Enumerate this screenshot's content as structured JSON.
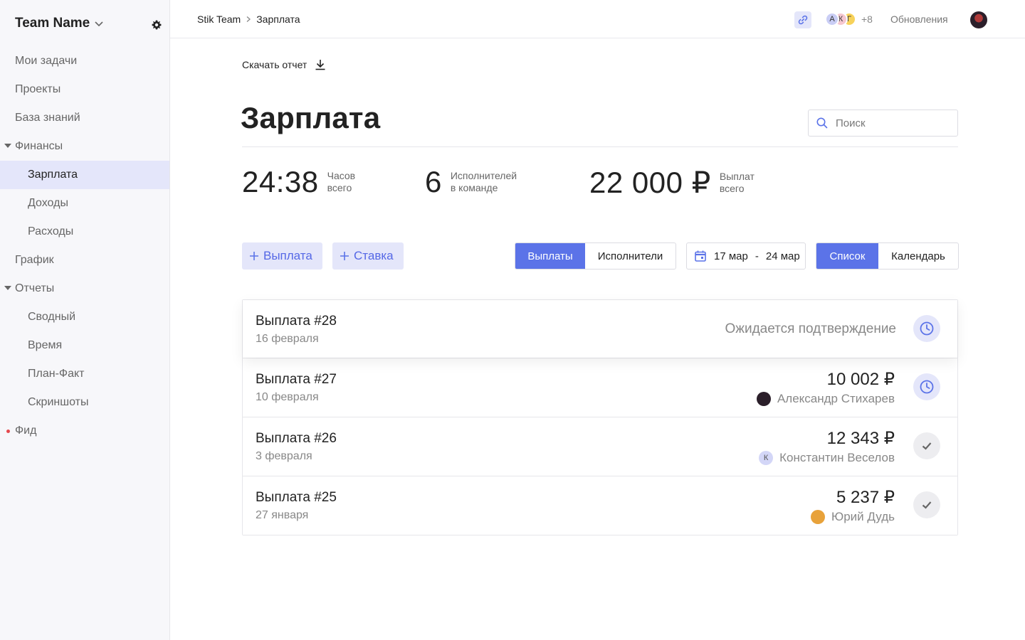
{
  "sidebar": {
    "team_name": "Team Name",
    "items": [
      {
        "label": "Мои задачи",
        "level": 0
      },
      {
        "label": "Проекты",
        "level": 0
      },
      {
        "label": "База знаний",
        "level": 0
      },
      {
        "label": "Финансы",
        "level": 0,
        "expanded": true
      },
      {
        "label": "Зарплата",
        "level": 1,
        "active": true
      },
      {
        "label": "Доходы",
        "level": 1
      },
      {
        "label": "Расходы",
        "level": 1
      },
      {
        "label": "График",
        "level": 0
      },
      {
        "label": "Отчеты",
        "level": 0,
        "expanded": true
      },
      {
        "label": "Сводный",
        "level": 1
      },
      {
        "label": "Время",
        "level": 1
      },
      {
        "label": "План-Факт",
        "level": 1
      },
      {
        "label": "Скриншоты",
        "level": 1
      },
      {
        "label": "Фид",
        "level": 0,
        "unread": true
      }
    ]
  },
  "topbar": {
    "breadcrumb": [
      "Stik Team",
      "Зарплата"
    ],
    "members": [
      {
        "initial": "А",
        "color": "#c9cdf5"
      },
      {
        "initial": "К",
        "color": "#f5c6cf"
      },
      {
        "initial": "Г",
        "color": "#f7d25a"
      }
    ],
    "members_more": "+8",
    "updates_label": "Обновления"
  },
  "main": {
    "download_label": "Скачать отчет",
    "title": "Зарплата",
    "search_placeholder": "Поиск",
    "stats": [
      {
        "value": "24:38",
        "label_line1": "Часов",
        "label_line2": "всего"
      },
      {
        "value": "6",
        "label_line1": "Исполнителей",
        "label_line2": "в команде"
      },
      {
        "value": "22 000 ₽",
        "label_line1": "Выплат",
        "label_line2": "всего"
      }
    ],
    "add_payment_label": "Выплата",
    "add_rate_label": "Ставка",
    "view_tabs": [
      {
        "label": "Выплаты",
        "active": true
      },
      {
        "label": "Исполнители",
        "active": false
      }
    ],
    "date_from": "17 мар",
    "date_sep": "-",
    "date_to": "24 мар",
    "mode_tabs": [
      {
        "label": "Список",
        "active": true
      },
      {
        "label": "Календарь",
        "active": false
      }
    ]
  },
  "payments": [
    {
      "title": "Выплата #28",
      "date": "16 февраля",
      "status": "Ожидается подтверждение",
      "amount": "",
      "person": "",
      "state": "pending"
    },
    {
      "title": "Выплата #27",
      "date": "10 февраля",
      "status": "",
      "amount": "10 002 ₽",
      "person": "Александр Стихарев",
      "person_initial": "",
      "person_color": "#2b1f2a",
      "state": "pending"
    },
    {
      "title": "Выплата #26",
      "date": "3 февраля",
      "status": "",
      "amount": "12 343 ₽",
      "person": "Константин Веселов",
      "person_initial": "К",
      "person_color": "#d3d6f7",
      "state": "done"
    },
    {
      "title": "Выплата #25",
      "date": "27 января",
      "status": "",
      "amount": "5 237 ₽",
      "person": "Юрий Дудь",
      "person_initial": "",
      "person_color": "#e8a23a",
      "state": "done"
    }
  ],
  "colors": {
    "accent": "#5b73e8",
    "accent_soft": "#e4e6fa",
    "muted": "#888888"
  }
}
